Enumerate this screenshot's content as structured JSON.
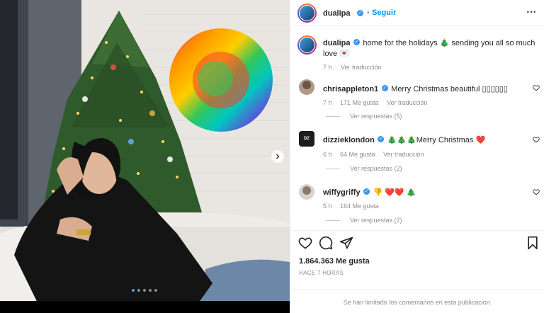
{
  "post": {
    "username": "dualipa",
    "follow_label": "Seguir",
    "more_icon": "more-options-icon",
    "caption_line1": "home for the holidays 🎄 sending you all so much",
    "caption_line2": "love 💌",
    "caption_time": "7 h",
    "translate_label": "Ver traducción",
    "likes": "1.864.363 Me gusta",
    "time_ago": "HACE 7 HORAS",
    "comments_limited": "Se han limitado los comentarios en esta publicación."
  },
  "comments": [
    {
      "username": "chrisappleton1",
      "text": "Merry Christmas beautiful ▯▯▯▯▯▯",
      "time": "7 h",
      "likes": "171 Me gusta",
      "translate": "Ver traducción",
      "replies": "Ver respuestas (5)"
    },
    {
      "username": "dizzieklondon",
      "text": "🎄🎄🎄Merry Christmas ❤️",
      "time": "6 h",
      "likes": "64 Me gusta",
      "translate": "Ver traducción",
      "replies": "Ver respuestas (2)"
    },
    {
      "username": "wiffygriffy",
      "text": "👎 ❤️❤️ 🎄",
      "time": "5 h",
      "likes": "164 Me gusta",
      "translate": "",
      "replies": "Ver respuestas (2)"
    }
  ],
  "carousel": {
    "count": 5,
    "active": 0
  },
  "colors": {
    "accent": "#0095f6",
    "verified": "#3897f0",
    "text": "#262626",
    "muted": "#8e8e8e"
  }
}
